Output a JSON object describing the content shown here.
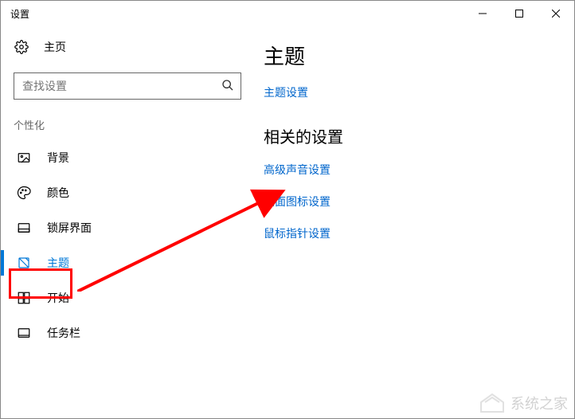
{
  "window": {
    "title": "设置"
  },
  "sidebar": {
    "home": "主页",
    "search_placeholder": "查找设置",
    "category": "个性化",
    "items": [
      {
        "label": "背景"
      },
      {
        "label": "颜色"
      },
      {
        "label": "锁屏界面"
      },
      {
        "label": "主题"
      },
      {
        "label": "开始"
      },
      {
        "label": "任务栏"
      }
    ]
  },
  "main": {
    "heading1": "主题",
    "link_theme_settings": "主题设置",
    "heading2": "相关的设置",
    "link_sound": "高级声音设置",
    "link_desktop_icons": "桌面图标设置",
    "link_pointer": "鼠标指针设置"
  },
  "watermark": "系统之家",
  "annotations": {
    "highlight": "sidebar-item-themes",
    "arrow_target": "link-desktop-icon-settings"
  }
}
